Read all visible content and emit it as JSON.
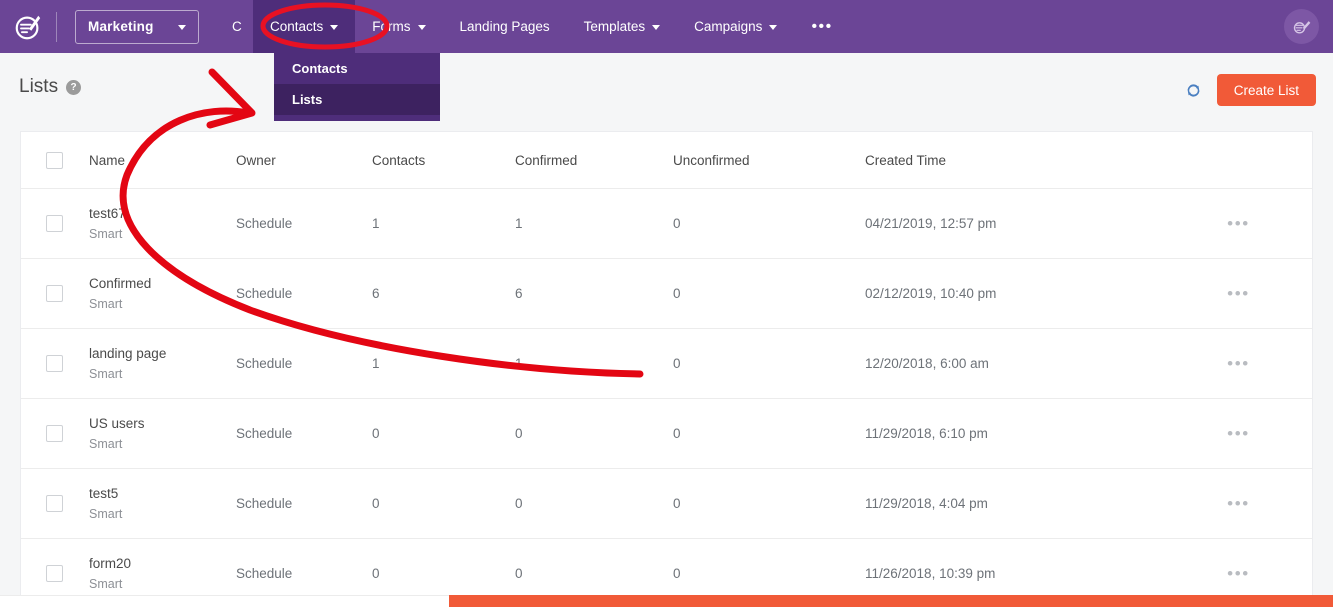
{
  "colors": {
    "header_purple": "#6b4596",
    "header_active_purple": "#4e2d7a",
    "dropdown_purple": "#4e2d7a",
    "dropdown_selected_purple": "#3d2260",
    "accent_orange": "#f15a38",
    "page_bg": "#f5f6f7",
    "annotation_red": "#e81123"
  },
  "topnav": {
    "logo_icon": "sendinblue-logo-icon",
    "brand_button": {
      "label": "Marketing",
      "caret_icon": "chevron-down-icon"
    },
    "items": [
      {
        "label": "C",
        "caret": false,
        "active": false,
        "clipped": true
      },
      {
        "label": "Contacts",
        "caret": true,
        "active": true,
        "clipped": false
      },
      {
        "label": "Forms",
        "caret": true,
        "active": false,
        "clipped": false
      },
      {
        "label": "Landing Pages",
        "caret": false,
        "active": false,
        "clipped": false
      },
      {
        "label": "Templates",
        "caret": true,
        "active": false,
        "clipped": false
      },
      {
        "label": "Campaigns",
        "caret": true,
        "active": false,
        "clipped": false
      },
      {
        "label": "•••",
        "caret": false,
        "active": false,
        "clipped": false
      }
    ],
    "avatar_icon": "user-avatar-icon"
  },
  "dropdown": {
    "items": [
      {
        "label": "Contacts",
        "selected": false
      },
      {
        "label": "Lists",
        "selected": true
      }
    ]
  },
  "pagehead": {
    "title": "Lists",
    "help_icon": "question-mark-icon",
    "help_glyph": "?",
    "refresh_icon": "refresh-icon",
    "create_button_label": "Create List"
  },
  "table": {
    "select_all_checkbox": "select-all-checkbox",
    "columns": [
      "Name",
      "Owner",
      "Contacts",
      "Confirmed",
      "Unconfirmed",
      "Created Time"
    ],
    "row_menu_glyph": "•••",
    "rows": [
      {
        "name": "test67",
        "type": "Smart",
        "owner": "Schedule",
        "contacts": "1",
        "confirmed": "1",
        "unconfirmed": "0",
        "created_time": "04/21/2019, 12:57 pm"
      },
      {
        "name": "Confirmed",
        "type": "Smart",
        "owner": "Schedule",
        "contacts": "6",
        "confirmed": "6",
        "unconfirmed": "0",
        "created_time": "02/12/2019, 10:40 pm"
      },
      {
        "name": "landing page",
        "type": "Smart",
        "owner": "Schedule",
        "contacts": "1",
        "confirmed": "1",
        "unconfirmed": "0",
        "created_time": "12/20/2018, 6:00 am"
      },
      {
        "name": "US users",
        "type": "Smart",
        "owner": "Schedule",
        "contacts": "0",
        "confirmed": "0",
        "unconfirmed": "0",
        "created_time": "11/29/2018, 6:10 pm"
      },
      {
        "name": "test5",
        "type": "Smart",
        "owner": "Schedule",
        "contacts": "0",
        "confirmed": "0",
        "unconfirmed": "0",
        "created_time": "11/29/2018, 4:04 pm"
      },
      {
        "name": "form20",
        "type": "Smart",
        "owner": "Schedule",
        "contacts": "0",
        "confirmed": "0",
        "unconfirmed": "0",
        "created_time": "11/26/2018, 10:39 pm"
      }
    ]
  },
  "annotations": [
    {
      "kind": "ellipse-highlight",
      "target": "Contacts nav item"
    },
    {
      "kind": "curved-arrow",
      "target": "Lists dropdown item"
    }
  ]
}
